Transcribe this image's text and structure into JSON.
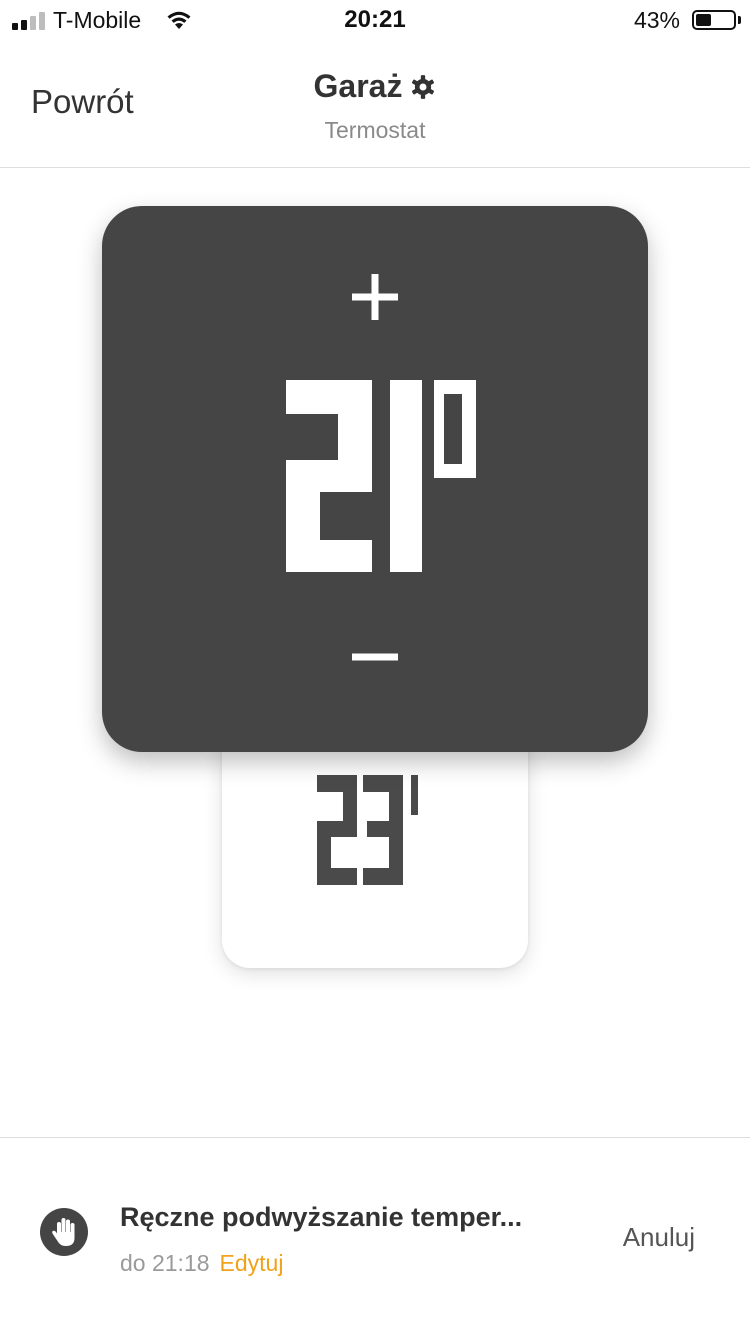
{
  "status_bar": {
    "carrier": "T-Mobile",
    "time": "20:21",
    "battery_percent": "43%",
    "battery_level": 0.43,
    "signal_bars_filled": 2,
    "signal_bars_total": 4
  },
  "nav": {
    "back_label": "Powrót",
    "title": "Garaż",
    "subtitle": "Termostat",
    "settings_icon": "gear-icon"
  },
  "thermostat": {
    "setpoint": 21,
    "setpoint_display": "21°",
    "current_temperature": 23,
    "current_display": "23",
    "increase_icon": "plus-icon",
    "decrease_icon": "minus-icon",
    "colors": {
      "screen": "#454545",
      "digits": "#ffffff",
      "body_digits": "#4a4a4a"
    }
  },
  "mode": {
    "icon": "hand-icon",
    "title": "Ręczne podwyższanie temper...",
    "until": "do 21:18",
    "edit_label": "Edytuj",
    "cancel_label": "Anuluj",
    "accent_color": "#f0a21a"
  }
}
